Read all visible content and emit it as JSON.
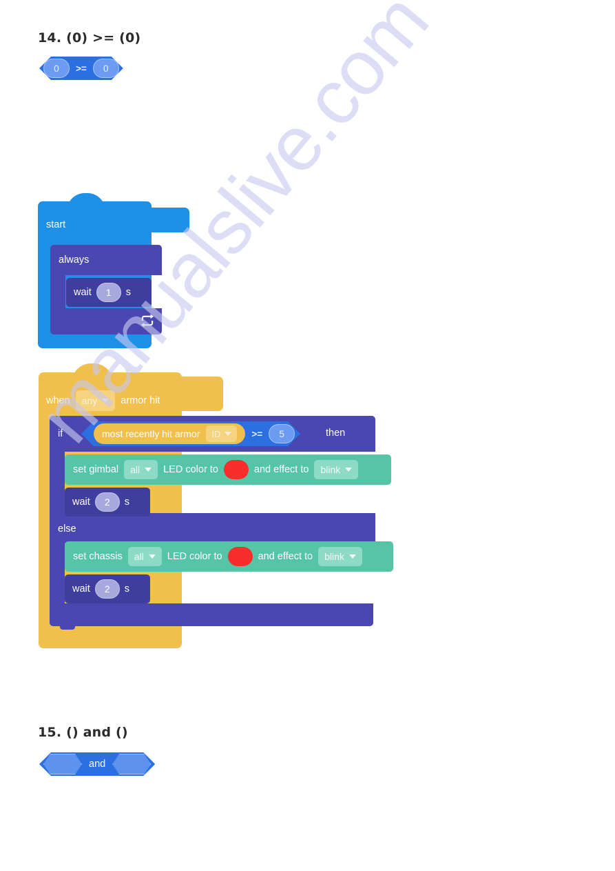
{
  "watermark": {
    "text": "manualslive.com",
    "color": "#c9c9ef"
  },
  "sections": [
    {
      "number": "14.",
      "heading": "14. (0) >= (0)",
      "block": {
        "type": "boolean-operator",
        "left_value": "0",
        "operator": ">=",
        "right_value": "0",
        "color": "#2b6fe0"
      }
    },
    {
      "number": "15.",
      "heading": "15. () and ()",
      "block": {
        "type": "boolean-operator",
        "left_value": "",
        "operator": "and",
        "right_value": "",
        "color": "#2b6fe0"
      }
    }
  ],
  "script_start": {
    "hat_label": "start",
    "hat_color": "#1e90e8",
    "loop": {
      "label": "always",
      "color": "#4a48b0",
      "loop_icon": "repeat-icon",
      "body": {
        "label": "wait",
        "value": "1",
        "unit": "s",
        "color": "#3f3d9e"
      }
    }
  },
  "script_armor": {
    "hat": {
      "prefix": "when",
      "dropdown_value": "any",
      "suffix": "armor hit",
      "color": "#f0bf4c"
    },
    "conditional": {
      "if_label": "if",
      "then_label": "then",
      "else_label": "else",
      "color": "#4a48b0",
      "condition": {
        "reporter_label": "most recently hit armor",
        "reporter_dropdown": "ID",
        "operator": ">=",
        "value": "5",
        "reporter_color": "#f0bf4c",
        "operator_color": "#2b6fe0"
      },
      "if_branch": [
        {
          "type": "set-led",
          "prefix": "set gimbal",
          "target_dropdown": "all",
          "mid_label": "LED color to",
          "color_value": "#fa2d2d",
          "effect_label": "and effect to",
          "effect_dropdown": "blink",
          "block_color": "#56c4a7"
        },
        {
          "type": "wait",
          "label": "wait",
          "value": "2",
          "unit": "s",
          "block_color": "#3f3d9e"
        }
      ],
      "else_branch": [
        {
          "type": "set-led",
          "prefix": "set chassis",
          "target_dropdown": "all",
          "mid_label": "LED color to",
          "color_value": "#fa2d2d",
          "effect_label": "and effect to",
          "effect_dropdown": "blink",
          "block_color": "#56c4a7"
        },
        {
          "type": "wait",
          "label": "wait",
          "value": "2",
          "unit": "s",
          "block_color": "#3f3d9e"
        }
      ]
    }
  }
}
